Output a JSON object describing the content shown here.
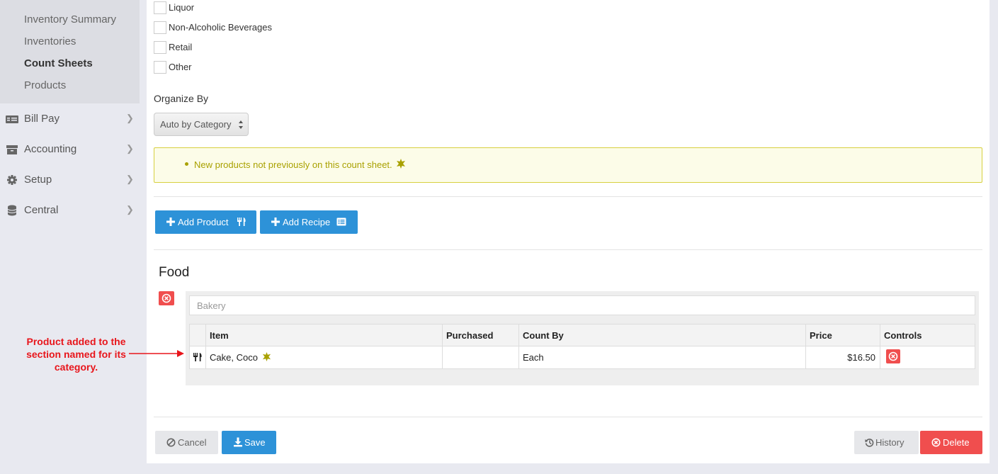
{
  "sidebar": {
    "subnav": [
      {
        "label": "Inventory Summary",
        "active": false
      },
      {
        "label": "Inventories",
        "active": false
      },
      {
        "label": "Count Sheets",
        "active": true
      },
      {
        "label": "Products",
        "active": false
      }
    ],
    "nav": [
      {
        "label": "Bill Pay",
        "icon": "bill-icon"
      },
      {
        "label": "Accounting",
        "icon": "archive-icon"
      },
      {
        "label": "Setup",
        "icon": "gear-icon"
      },
      {
        "label": "Central",
        "icon": "database-icon"
      }
    ]
  },
  "categories": [
    "Liquor",
    "Non-Alcoholic Beverages",
    "Retail",
    "Other"
  ],
  "organize": {
    "label": "Organize By",
    "selected": "Auto by Category"
  },
  "alert": {
    "text": "New products not previously on this count sheet."
  },
  "buttons": {
    "add_product": "Add Product",
    "add_recipe": "Add Recipe",
    "cancel": "Cancel",
    "save": "Save",
    "history": "History",
    "delete": "Delete"
  },
  "section": {
    "title": "Food",
    "group_placeholder": "Bakery",
    "columns": [
      "Item",
      "Purchased",
      "Count By",
      "Price",
      "Controls"
    ],
    "rows": [
      {
        "item": "Cake, Coco",
        "purchased": "",
        "count_by": "Each",
        "price": "$16.50",
        "is_new": true
      }
    ]
  },
  "annotation": {
    "text": "Product added to the section named for its category."
  },
  "colors": {
    "primary": "#2d92d8",
    "danger": "#f04e4e",
    "alert_text": "#a9a100",
    "annotation": "#e8151b"
  }
}
